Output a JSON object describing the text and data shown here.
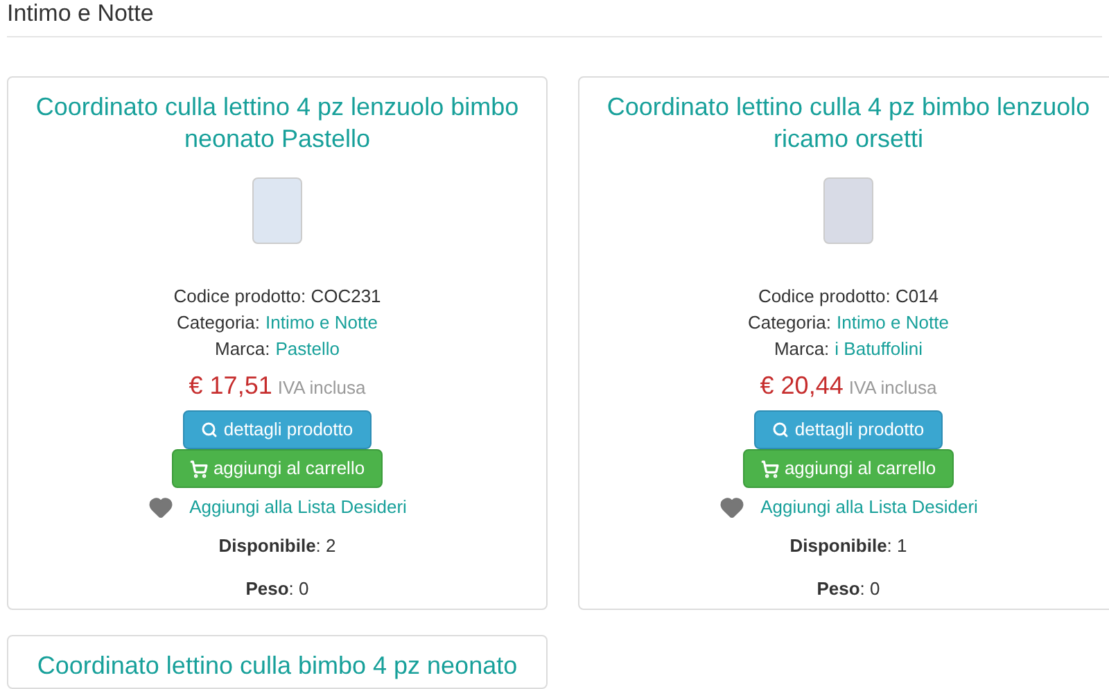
{
  "heading": "Intimo e Notte",
  "products": [
    {
      "title": "Coordinato culla lettino 4 pz lenzuolo bimbo neonato Pastello",
      "code": "Codice prodotto: COC231",
      "category_label": "Categoria:",
      "category": "Intimo e Notte",
      "brand_label": "Marca:",
      "brand": "Pastello",
      "price": "€ 17,51",
      "vat_note": "IVA inclusa",
      "details_button": "dettagli prodotto",
      "cart_button": "aggiungi al carrello",
      "wishlist": "Aggiungi alla Lista Desideri",
      "availability": "**Disponibile**: 2",
      "weight": "**Peso**: 0"
    },
    {
      "title": "Coordinato lettino culla 4 pz bimbo lenzuolo ricamo orsetti",
      "code": "Codice prodotto: C014",
      "category_label": "Categoria:",
      "category": "Intimo e Notte",
      "brand_label": "Marca:",
      "brand": "i Batuffolini",
      "price": "€ 20,44",
      "vat_note": "IVA inclusa",
      "details_button": "dettagli prodotto",
      "cart_button": "aggiungi al carrello",
      "wishlist": "Aggiungi alla Lista Desideri",
      "availability": "**Disponibile**: 1",
      "weight": "**Peso**: 0"
    },
    {
      "title": "Coordinato lettino culla bimbo 4 pz neonato"
    }
  ]
}
